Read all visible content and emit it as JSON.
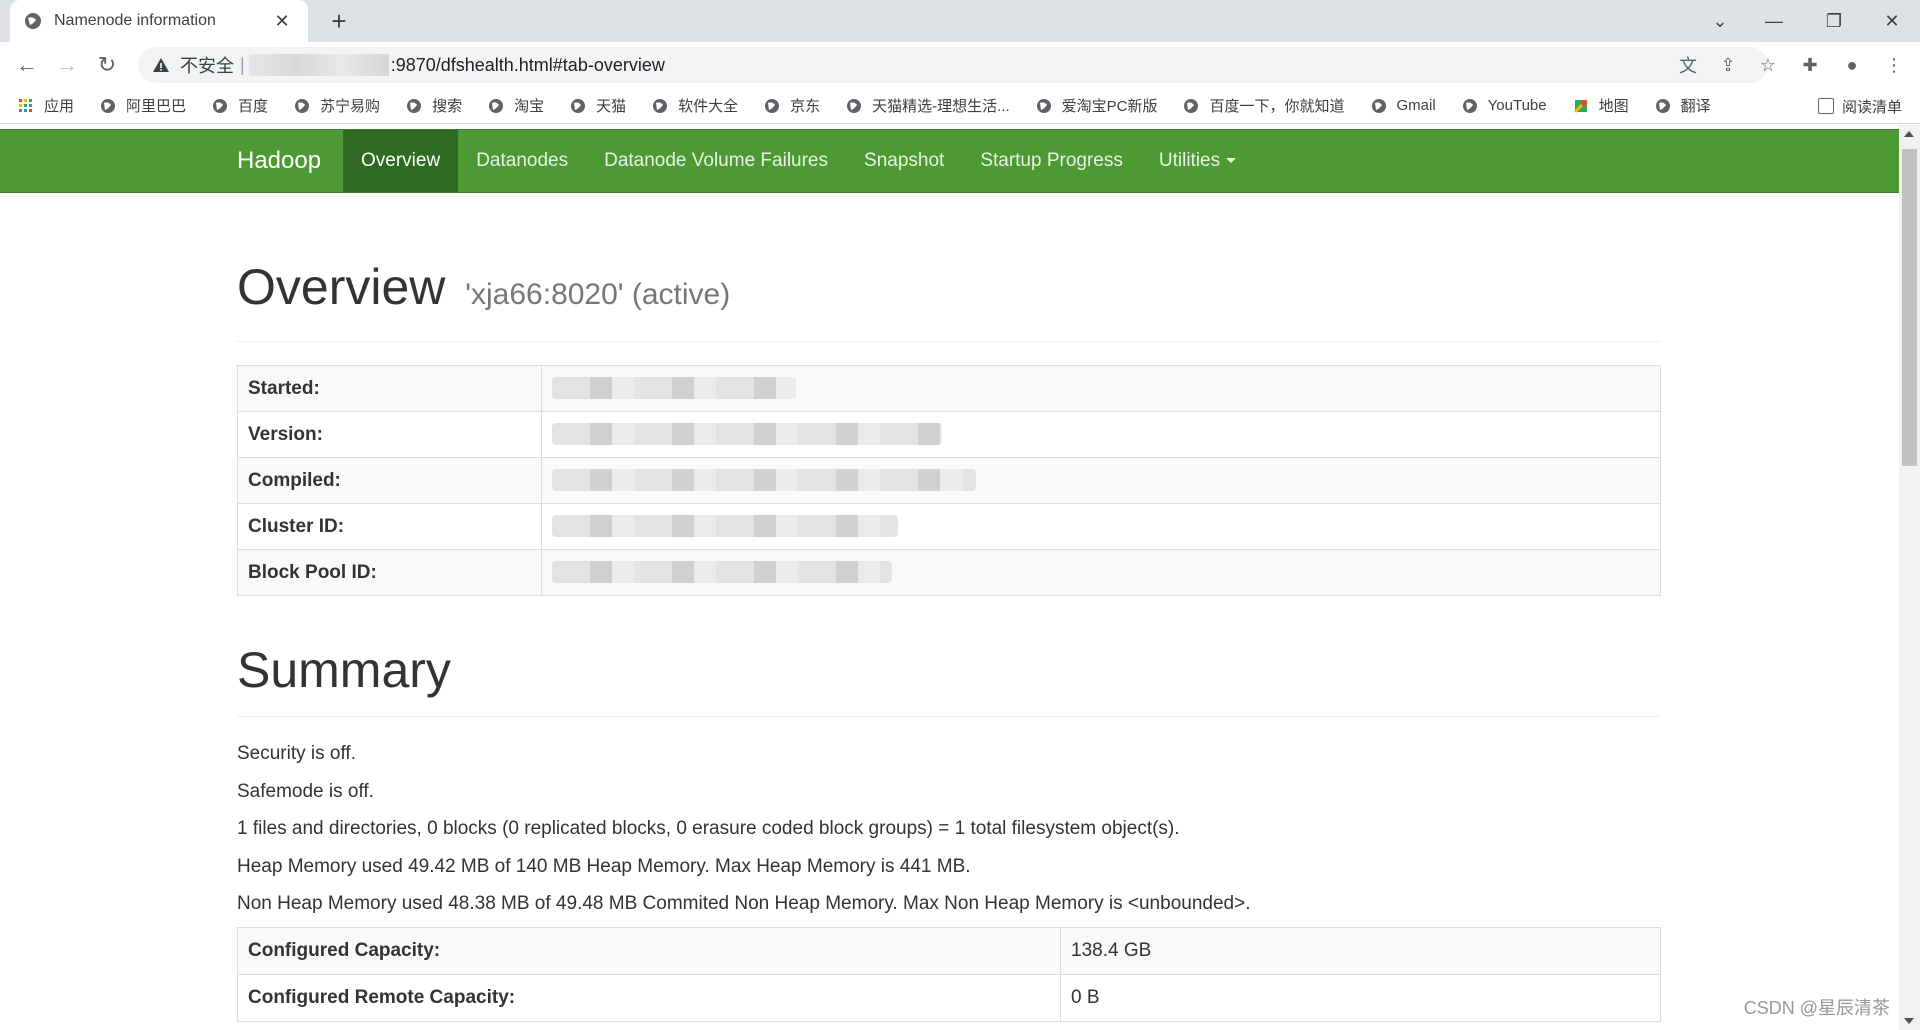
{
  "browser": {
    "tab_title": "Namenode information",
    "new_tab": "+",
    "insecure_label": "不安全",
    "separator": "|",
    "url": ":9870/dfshealth.html#tab-overview",
    "bookmarks": [
      "应用",
      "阿里巴巴",
      "百度",
      "苏宁易购",
      "搜索",
      "淘宝",
      "天猫",
      "软件大全",
      "京东",
      "天猫精选-理想生活...",
      "爱淘宝PC新版",
      "百度一下，你就知道",
      "Gmail",
      "YouTube",
      "地图",
      "翻译"
    ],
    "reading_list": "阅读清单"
  },
  "navbar": {
    "brand": "Hadoop",
    "items": [
      "Overview",
      "Datanodes",
      "Datanode Volume Failures",
      "Snapshot",
      "Startup Progress",
      "Utilities"
    ],
    "active_color": "#2f6a22",
    "bar_color": "#4d9a35"
  },
  "overview": {
    "title": "Overview",
    "subtitle": "'xja66:8020' (active)",
    "rows": [
      {
        "label": "Started:"
      },
      {
        "label": "Version:"
      },
      {
        "label": "Compiled:"
      },
      {
        "label": "Cluster ID:"
      },
      {
        "label": "Block Pool ID:"
      }
    ]
  },
  "summary": {
    "title": "Summary",
    "lines": [
      "Security is off.",
      "Safemode is off.",
      "1 files and directories, 0 blocks (0 replicated blocks, 0 erasure coded block groups) = 1 total filesystem object(s).",
      "Heap Memory used 49.42 MB of 140 MB Heap Memory. Max Heap Memory is 441 MB.",
      "Non Heap Memory used 48.38 MB of 49.48 MB Commited Non Heap Memory. Max Non Heap Memory is <unbounded>."
    ],
    "capacity_rows": [
      {
        "label": "Configured Capacity:",
        "value": "138.4 GB"
      },
      {
        "label": "Configured Remote Capacity:",
        "value": "0 B"
      }
    ]
  },
  "watermark": "CSDN @星辰清茶"
}
